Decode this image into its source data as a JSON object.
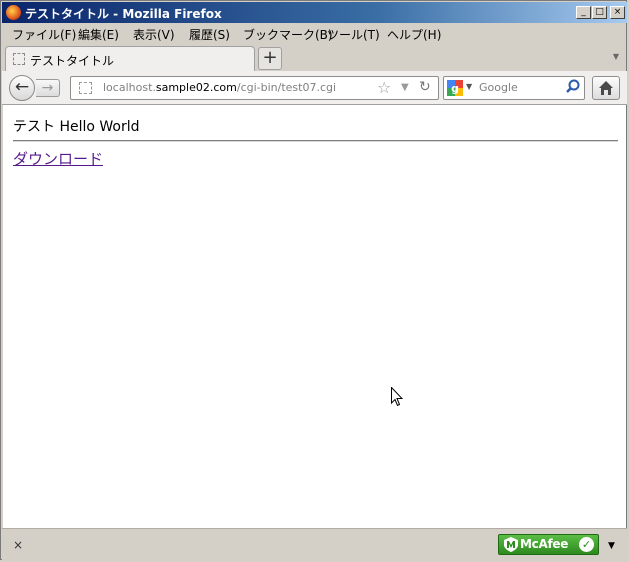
{
  "window": {
    "title": "テストタイトル - Mozilla Firefox",
    "controls": {
      "minimize": "_",
      "maximize": "□",
      "close": "×"
    }
  },
  "menu": [
    "ファイル(F)",
    "編集(E)",
    "表示(V)",
    "履歴(S)",
    "ブックマーク(B)",
    "ツール(T)",
    "ヘルプ(H)"
  ],
  "tab": {
    "label": "テストタイトル",
    "new_tab": "+"
  },
  "navigation": {
    "url_prefix": "localhost.",
    "url_host": "sample02.com",
    "url_path": "/cgi-bin/test07.cgi"
  },
  "search": {
    "placeholder": "Google"
  },
  "page": {
    "heading": "テスト Hello World",
    "link": "ダウンロード"
  },
  "statusbar": {
    "close": "×",
    "addon_label": "McAfee",
    "addon_status": "✓",
    "addon_color": "#3fa32c"
  }
}
